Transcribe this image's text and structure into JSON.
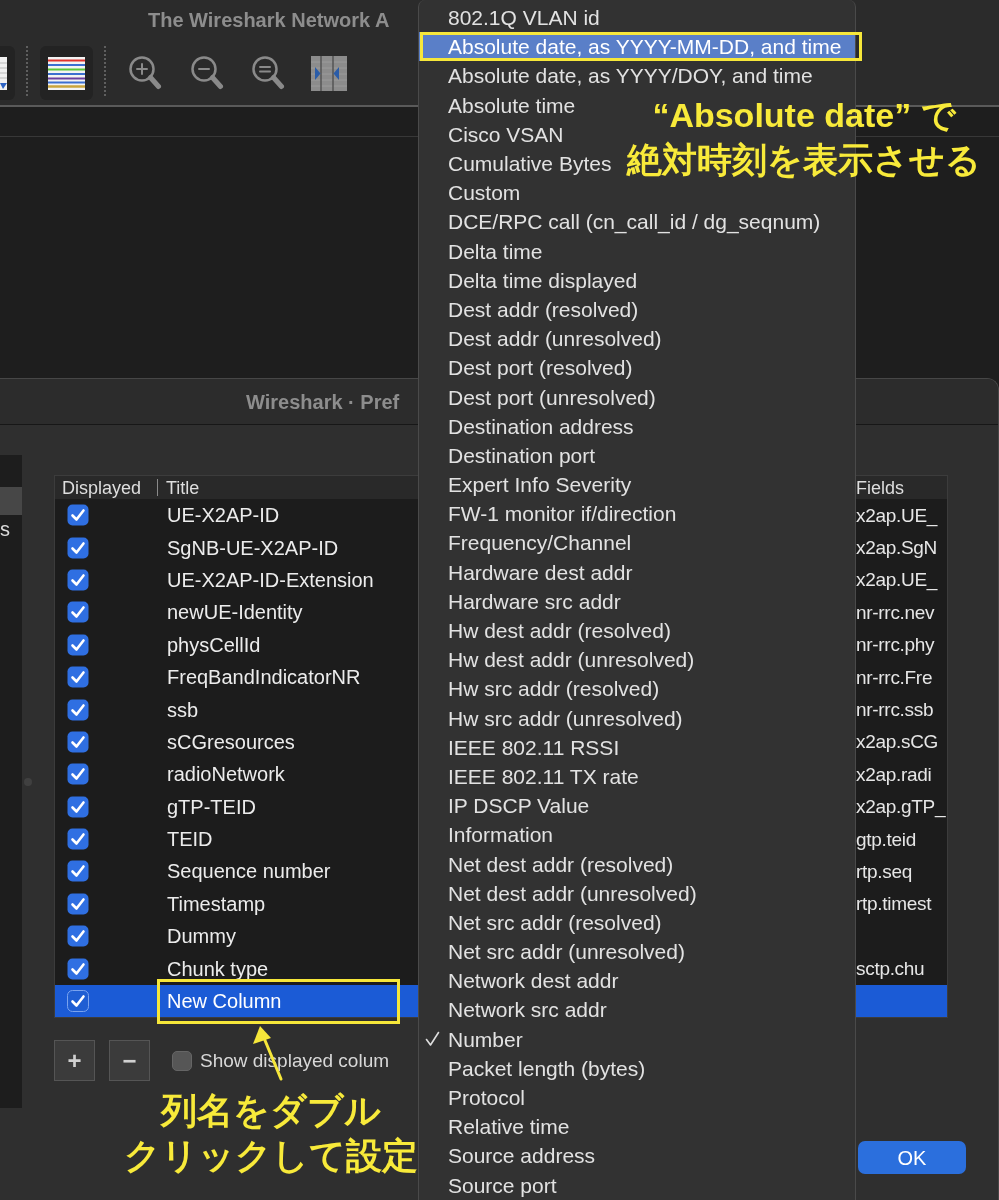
{
  "main_window": {
    "title": "The Wireshark Network A",
    "toolbar": [
      {
        "kind": "packet-list",
        "on": true
      },
      {
        "kind": "separator"
      },
      {
        "kind": "colorize",
        "on": true
      },
      {
        "kind": "separator"
      },
      {
        "kind": "zoom-in",
        "on": false
      },
      {
        "kind": "zoom-out",
        "on": false
      },
      {
        "kind": "zoom-reset",
        "on": false
      },
      {
        "kind": "resize-columns",
        "on": false
      }
    ]
  },
  "dialog": {
    "title": "Wireshark · Pref",
    "sidebar": {
      "items": [
        {
          "selected": true
        },
        {
          "label": "s",
          "selected": false
        }
      ]
    },
    "columns_table": {
      "columns": [
        "Displayed",
        "Title",
        "Fields"
      ],
      "rows": [
        {
          "displayed": true,
          "title": "UE-X2AP-ID",
          "fields": "x2ap.UE_",
          "selected": false
        },
        {
          "displayed": true,
          "title": "SgNB-UE-X2AP-ID",
          "fields": "x2ap.SgN",
          "selected": false
        },
        {
          "displayed": true,
          "title": "UE-X2AP-ID-Extension",
          "fields": "x2ap.UE_",
          "selected": false
        },
        {
          "displayed": true,
          "title": "newUE-Identity",
          "fields": "nr-rrc.nev",
          "selected": false
        },
        {
          "displayed": true,
          "title": "physCellId",
          "fields": "nr-rrc.phy",
          "selected": false
        },
        {
          "displayed": true,
          "title": "FreqBandIndicatorNR",
          "fields": "nr-rrc.Fre",
          "selected": false
        },
        {
          "displayed": true,
          "title": "ssb",
          "fields": "nr-rrc.ssb",
          "selected": false
        },
        {
          "displayed": true,
          "title": "sCGresources",
          "fields": "x2ap.sCG",
          "selected": false
        },
        {
          "displayed": true,
          "title": "radioNetwork",
          "fields": "x2ap.radi",
          "selected": false
        },
        {
          "displayed": true,
          "title": "gTP-TEID",
          "fields": "x2ap.gTP_",
          "selected": false
        },
        {
          "displayed": true,
          "title": "TEID",
          "fields": "gtp.teid",
          "selected": false
        },
        {
          "displayed": true,
          "title": "Sequence number",
          "fields": "rtp.seq",
          "selected": false
        },
        {
          "displayed": true,
          "title": "Timestamp",
          "fields": "rtp.timest",
          "selected": false
        },
        {
          "displayed": true,
          "title": "Dummy",
          "selected": false
        },
        {
          "displayed": true,
          "title": "Chunk type",
          "fields": "sctp.chu",
          "selected": false
        },
        {
          "displayed": true,
          "title": "New Column",
          "selected": true
        }
      ]
    },
    "add_button": "+",
    "remove_button": "−",
    "show_displayed": {
      "label": "Show displayed colum",
      "checked": false
    },
    "ok_button": "OK"
  },
  "menu": {
    "items": [
      {
        "label": "802.1Q VLAN id",
        "selected": false,
        "highlighted": false
      },
      {
        "label": "Absolute date, as YYYY-MM-DD, and time",
        "selected": false,
        "highlighted": true
      },
      {
        "label": "Absolute date, as YYYY/DOY, and time",
        "selected": false,
        "highlighted": false
      },
      {
        "label": "Absolute time",
        "selected": false,
        "highlighted": false
      },
      {
        "label": "Cisco VSAN",
        "selected": false,
        "highlighted": false
      },
      {
        "label": "Cumulative Bytes",
        "selected": false,
        "highlighted": false
      },
      {
        "label": "Custom",
        "selected": false,
        "highlighted": false
      },
      {
        "label": "DCE/RPC call (cn_call_id / dg_seqnum)",
        "selected": false,
        "highlighted": false
      },
      {
        "label": "Delta time",
        "selected": false,
        "highlighted": false
      },
      {
        "label": "Delta time displayed",
        "selected": false,
        "highlighted": false
      },
      {
        "label": "Dest addr (resolved)",
        "selected": false,
        "highlighted": false
      },
      {
        "label": "Dest addr (unresolved)",
        "selected": false,
        "highlighted": false
      },
      {
        "label": "Dest port (resolved)",
        "selected": false,
        "highlighted": false
      },
      {
        "label": "Dest port (unresolved)",
        "selected": false,
        "highlighted": false
      },
      {
        "label": "Destination address",
        "selected": false,
        "highlighted": false
      },
      {
        "label": "Destination port",
        "selected": false,
        "highlighted": false
      },
      {
        "label": "Expert Info Severity",
        "selected": false,
        "highlighted": false
      },
      {
        "label": "FW-1 monitor if/direction",
        "selected": false,
        "highlighted": false
      },
      {
        "label": "Frequency/Channel",
        "selected": false,
        "highlighted": false
      },
      {
        "label": "Hardware dest addr",
        "selected": false,
        "highlighted": false
      },
      {
        "label": "Hardware src addr",
        "selected": false,
        "highlighted": false
      },
      {
        "label": "Hw dest addr (resolved)",
        "selected": false,
        "highlighted": false
      },
      {
        "label": "Hw dest addr (unresolved)",
        "selected": false,
        "highlighted": false
      },
      {
        "label": "Hw src addr (resolved)",
        "selected": false,
        "highlighted": false
      },
      {
        "label": "Hw src addr (unresolved)",
        "selected": false,
        "highlighted": false
      },
      {
        "label": "IEEE 802.11 RSSI",
        "selected": false,
        "highlighted": false
      },
      {
        "label": "IEEE 802.11 TX rate",
        "selected": false,
        "highlighted": false
      },
      {
        "label": "IP DSCP Value",
        "selected": false,
        "highlighted": false
      },
      {
        "label": "Information",
        "selected": false,
        "highlighted": false
      },
      {
        "label": "Net dest addr (resolved)",
        "selected": false,
        "highlighted": false
      },
      {
        "label": "Net dest addr (unresolved)",
        "selected": false,
        "highlighted": false
      },
      {
        "label": "Net src addr (resolved)",
        "selected": false,
        "highlighted": false
      },
      {
        "label": "Net src addr (unresolved)",
        "selected": false,
        "highlighted": false
      },
      {
        "label": "Network dest addr",
        "selected": false,
        "highlighted": false
      },
      {
        "label": "Network src addr",
        "selected": false,
        "highlighted": false
      },
      {
        "label": "Number",
        "selected": true,
        "highlighted": false
      },
      {
        "label": "Packet length (bytes)",
        "selected": false,
        "highlighted": false
      },
      {
        "label": "Protocol",
        "selected": false,
        "highlighted": false
      },
      {
        "label": "Relative time",
        "selected": false,
        "highlighted": false
      },
      {
        "label": "Source address",
        "selected": false,
        "highlighted": false
      },
      {
        "label": "Source port",
        "selected": false,
        "highlighted": false
      }
    ]
  },
  "annotations": {
    "menu_callout": {
      "lines": [
        "“Absolute date” で",
        "絶対時刻を表示させる"
      ],
      "frame": true
    },
    "column_callout": {
      "lines": [
        "列名をダブル",
        "クリックして設定"
      ],
      "frame": true,
      "arrow": true
    }
  }
}
